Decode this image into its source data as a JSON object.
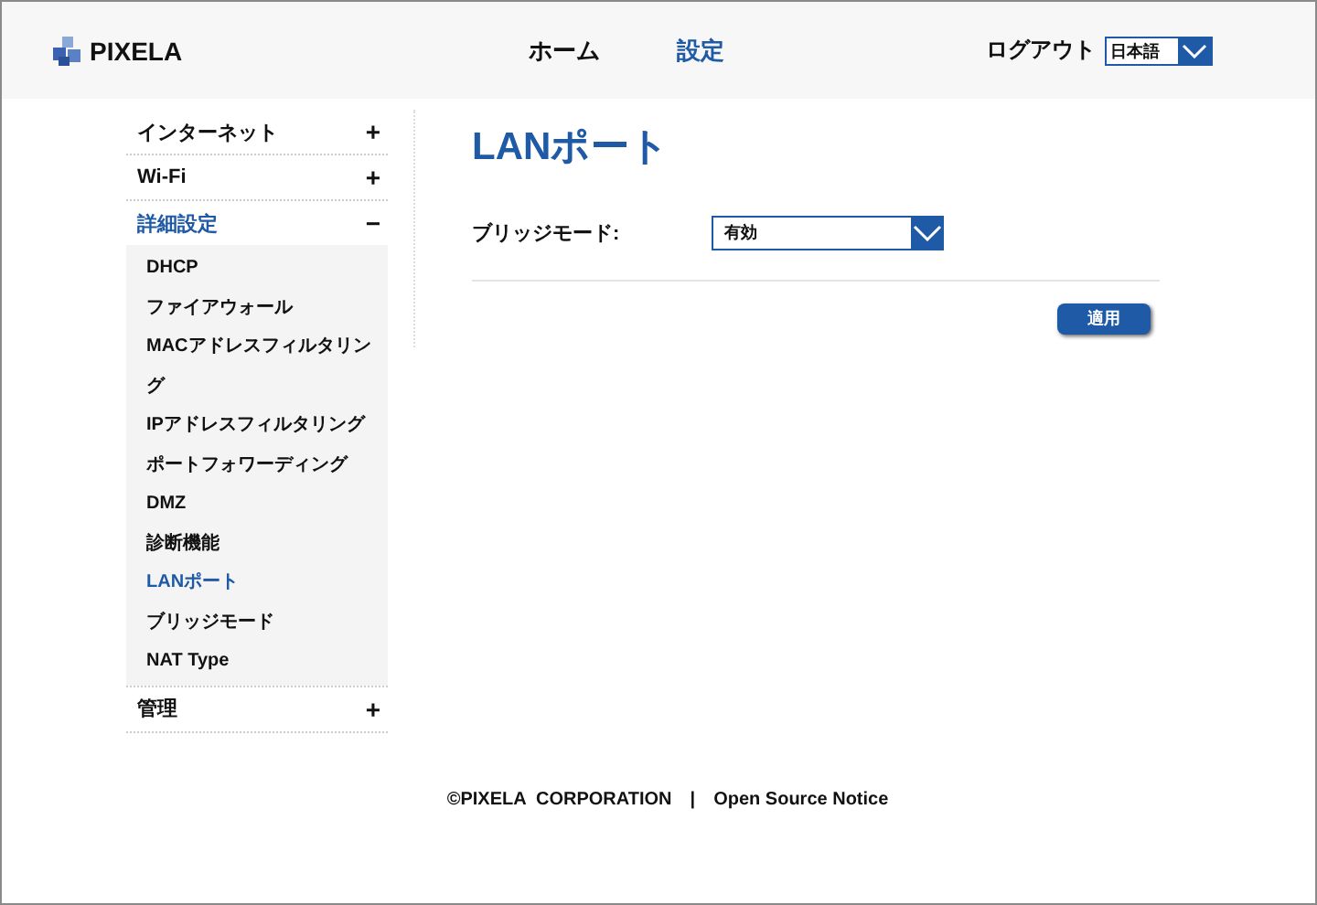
{
  "header": {
    "logo": "PIXELA",
    "nav": [
      {
        "label": "ホーム",
        "selected": false
      },
      {
        "label": "設定",
        "selected": true
      }
    ],
    "logout": "ログアウト",
    "language": "日本語"
  },
  "sidebar": {
    "sections": [
      {
        "label": "インターネット",
        "expanded": false,
        "toggle": "+"
      },
      {
        "label": "Wi-Fi",
        "expanded": false,
        "toggle": "+"
      },
      {
        "label": "詳細設定",
        "expanded": true,
        "toggle": "−",
        "children": [
          {
            "label": "DHCP",
            "selected": false
          },
          {
            "label": "ファイアウォール",
            "selected": false
          },
          {
            "label": "MACアドレスフィルタリング",
            "selected": false
          },
          {
            "label": "IPアドレスフィルタリング",
            "selected": false
          },
          {
            "label": "ポートフォワーディング",
            "selected": false
          },
          {
            "label": "DMZ",
            "selected": false
          },
          {
            "label": "診断機能",
            "selected": false
          },
          {
            "label": "LANポート",
            "selected": true
          },
          {
            "label": "ブリッジモード",
            "selected": false
          },
          {
            "label": "NAT Type",
            "selected": false
          }
        ]
      },
      {
        "label": "管理",
        "expanded": false,
        "toggle": "+"
      }
    ]
  },
  "main": {
    "title": "LANポート",
    "field": {
      "label": "ブリッジモード:",
      "value": "有効"
    },
    "apply_button": "適用"
  },
  "footer": {
    "copyright": "©PIXELA  CORPORATION",
    "separator": "|",
    "link": "Open Source Notice"
  }
}
